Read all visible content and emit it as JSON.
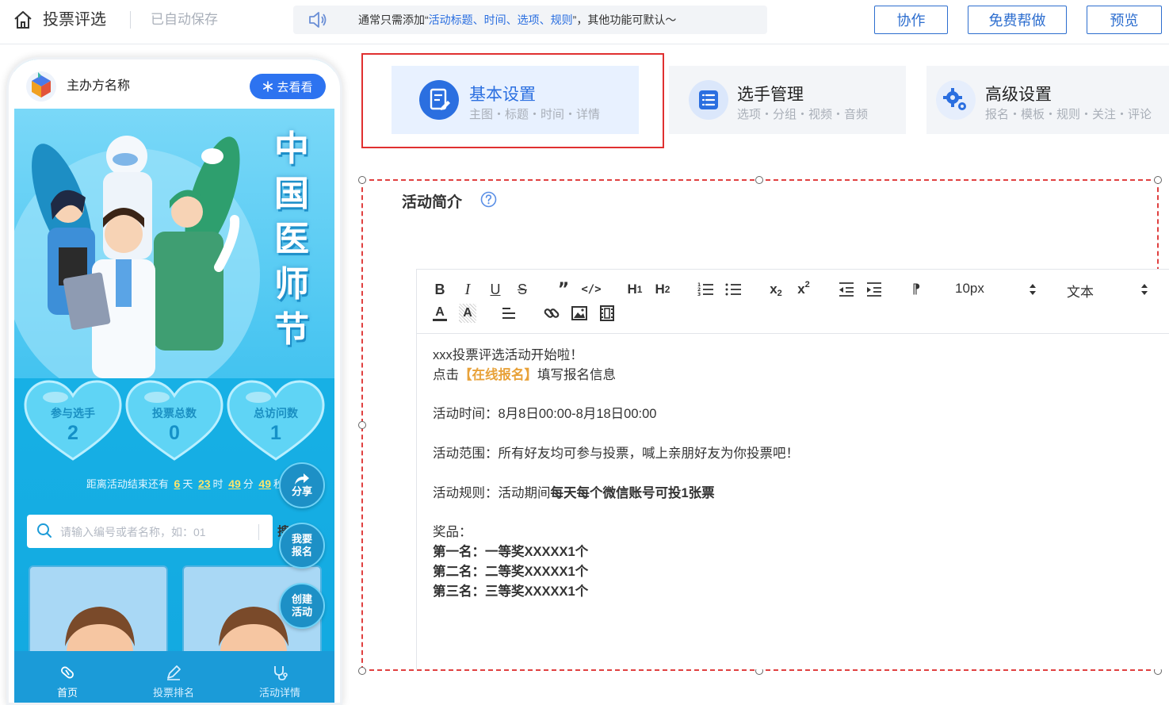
{
  "header": {
    "title": "投票评选",
    "autosave": "已自动保存",
    "notice": {
      "prefix": "通常只需添加“",
      "highlight": "活动标题、时间、选项、规则",
      "suffix": "”，其他功能可默认～"
    },
    "buttons": {
      "collaborate": "协作",
      "free_help": "免费帮做",
      "preview": "预览"
    }
  },
  "phone": {
    "org_name": "主办方名称",
    "goto_button": "去看看",
    "banner_title": [
      "中",
      "国",
      "医",
      "师",
      "节"
    ],
    "stats": [
      {
        "label": "参与选手",
        "value": "2"
      },
      {
        "label": "投票总数",
        "value": "0"
      },
      {
        "label": "总访问数",
        "value": "1"
      }
    ],
    "countdown": {
      "prefix": "距离活动结束还有",
      "days": "6",
      "days_unit": "天",
      "hours": "23",
      "hours_unit": "时",
      "minutes": "49",
      "minutes_unit": "分",
      "seconds": "49",
      "seconds_unit": "秒"
    },
    "fab": {
      "share": "分享",
      "signup_line1": "我要",
      "signup_line2": "报名",
      "create_line1": "创建",
      "create_line2": "活动"
    },
    "search": {
      "placeholder": "请输入编号或者名称，如：01",
      "button": "搜"
    },
    "tabs": [
      {
        "label": "首页"
      },
      {
        "label": "投票排名"
      },
      {
        "label": "活动详情"
      }
    ]
  },
  "steps": [
    {
      "title": "基本设置",
      "subtitle": "主图・标题・时间・详情"
    },
    {
      "title": "选手管理",
      "subtitle": "选项・分组・视频・音频"
    },
    {
      "title": "高级设置",
      "subtitle": "报名・模板・规则・关注・评论"
    }
  ],
  "section": {
    "title": "活动简介"
  },
  "editor": {
    "toolbar": {
      "font_size": "10px",
      "block_type": "文本"
    },
    "content": {
      "line1": "xxx投票评选活动开始啦！",
      "line2_prefix": "点击",
      "line2_highlight": "【在线报名】",
      "line2_suffix": "填写报名信息",
      "time": "活动时间：8月8日00:00-8月18日00:00",
      "scope": "活动范围：所有好友均可参与投票，喊上亲朋好友为你投票吧！",
      "rules_prefix": "活动规则：活动期间",
      "rules_bold": "每天每个微信账号可投1张票",
      "prize_label": "奖品：",
      "prize1": "第一名：一等奖XXXXX1个",
      "prize2": "第二名：二等奖XXXXX1个",
      "prize3": "第三名：三等奖XXXXX1个"
    }
  },
  "colors": {
    "accent": "#2d6ecf",
    "highlight_text": "#2b6fe0",
    "selection_frame": "#e03030",
    "phone_primary": "#1b9bd8",
    "countdown_number": "#ffe56a",
    "editor_orange": "#e8a23a"
  }
}
